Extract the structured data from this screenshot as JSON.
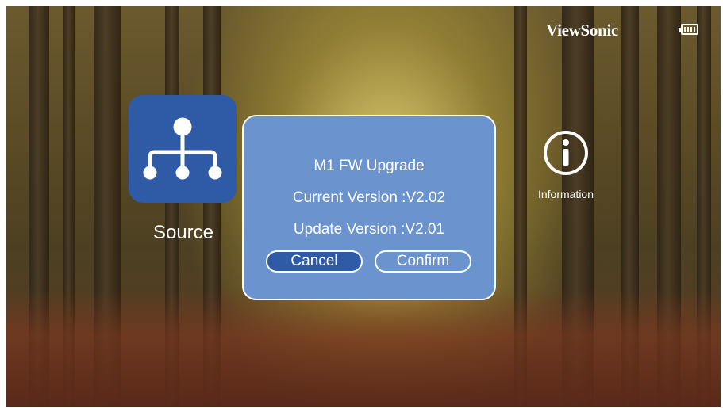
{
  "header": {
    "brand": "ViewSonic",
    "battery_icon": "battery-icon"
  },
  "apps": [
    {
      "label": "Source",
      "icon": "source-network-icon",
      "tile_color": "#2f5aa6"
    },
    {
      "label": "Information",
      "icon": "info-circle-icon"
    }
  ],
  "dialog": {
    "title": "M1 FW Upgrade",
    "current_version": "Current Version :V2.02",
    "update_version": "Update Version :V2.01",
    "cancel_label": "Cancel",
    "confirm_label": "Confirm",
    "background": "#6b94cf",
    "selected_button": "Cancel"
  }
}
